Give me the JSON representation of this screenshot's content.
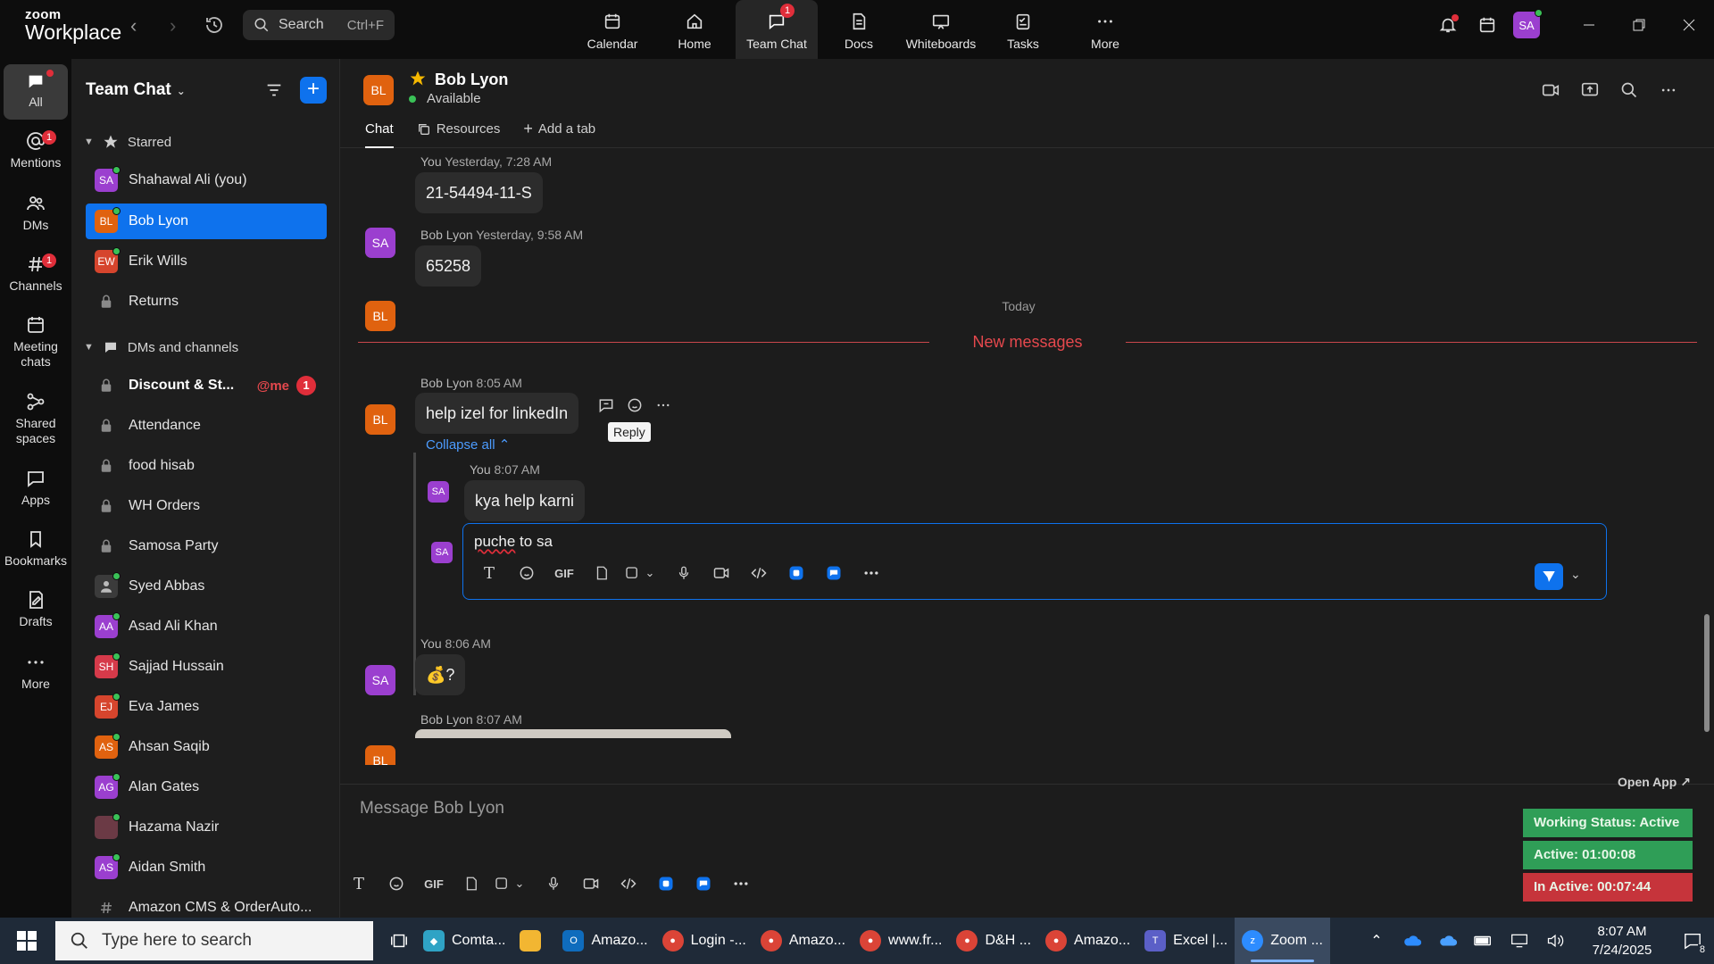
{
  "app": {
    "logo_top": "zoom",
    "logo_bottom": "Workplace"
  },
  "search": {
    "label": "Search",
    "shortcut": "Ctrl+F"
  },
  "topnav": [
    {
      "label": "Calendar",
      "icon": "calendar-icon"
    },
    {
      "label": "Home",
      "icon": "home-icon"
    },
    {
      "label": "Team Chat",
      "icon": "chat-icon",
      "badge": "1",
      "active": true
    },
    {
      "label": "Docs",
      "icon": "docs-icon"
    },
    {
      "label": "Whiteboards",
      "icon": "whiteboard-icon"
    },
    {
      "label": "Tasks",
      "icon": "tasks-icon"
    },
    {
      "label": "More",
      "icon": "more-icon"
    }
  ],
  "user": {
    "initials": "SA"
  },
  "rail": [
    {
      "label": "All"
    },
    {
      "label": "Mentions",
      "badge": "1"
    },
    {
      "label": "DMs"
    },
    {
      "label": "Channels",
      "badge": "1"
    },
    {
      "label": "Meeting chats"
    },
    {
      "label": "Shared spaces"
    },
    {
      "label": "Apps"
    },
    {
      "label": "Bookmarks"
    },
    {
      "label": "Drafts"
    },
    {
      "label": "More"
    }
  ],
  "sidebar": {
    "title": "Team Chat",
    "starred_label": "Starred",
    "starred": [
      {
        "initials": "SA",
        "name": "Shahawal Ali (you)",
        "color": "#9b3fcf"
      },
      {
        "initials": "BL",
        "name": "Bob Lyon",
        "color": "#e0620f"
      },
      {
        "initials": "EW",
        "name": "Erik Wills",
        "color": "#d6452d"
      },
      {
        "initials": "",
        "name": "Returns",
        "color": ""
      }
    ],
    "dms_label": "DMs and channels",
    "dms": [
      {
        "initials": "",
        "name": "Discount & St...",
        "mention": "@me",
        "count": "1"
      },
      {
        "initials": "",
        "name": "Attendance"
      },
      {
        "initials": "",
        "name": "food hisab"
      },
      {
        "initials": "",
        "name": "WH Orders"
      },
      {
        "initials": "",
        "name": "Samosa Party"
      },
      {
        "initials": "",
        "name": "Syed Abbas",
        "color": "#3b3b3b"
      },
      {
        "initials": "AA",
        "name": "Asad Ali Khan",
        "color": "#9b3fcf"
      },
      {
        "initials": "SH",
        "name": "Sajjad Hussain",
        "color": "#d63a4a"
      },
      {
        "initials": "EJ",
        "name": "Eva James",
        "color": "#d6452d"
      },
      {
        "initials": "AS",
        "name": "Ahsan Saqib",
        "color": "#e0620f"
      },
      {
        "initials": "AG",
        "name": "Alan Gates",
        "color": "#9b3fcf"
      },
      {
        "initials": "",
        "name": "Hazama Nazir",
        "color": "#6b3a45"
      },
      {
        "initials": "AS",
        "name": "Aidan Smith",
        "color": "#9b3fcf"
      },
      {
        "initials": "",
        "name": "Amazon CMS & OrderAuto..."
      }
    ]
  },
  "chat": {
    "contact_initials": "BL",
    "contact_name": "Bob Lyon",
    "status": "Available",
    "tabs": [
      "Chat",
      "Resources",
      "Add a tab"
    ],
    "messages": [
      {
        "initials": "SA",
        "author": "You",
        "time": "Yesterday, 7:28 AM",
        "text": "21-54494-11-S"
      },
      {
        "initials": "BL",
        "author": "Bob Lyon",
        "time": "Yesterday, 9:58 AM",
        "text": "65258"
      }
    ],
    "today_label": "Today",
    "new_messages_label": "New messages",
    "thread_parent": {
      "initials": "BL",
      "author": "Bob Lyon",
      "time": "8:05 AM",
      "text": "help izel for linkedIn"
    },
    "tooltip": "Reply",
    "collapse_label": "Collapse all",
    "thread_reply": {
      "initials": "SA",
      "author": "You",
      "time": "8:07 AM",
      "text": "kya help karni"
    },
    "reply_draft": {
      "initials": "SA",
      "word1": "puche",
      "rest": " to sa"
    },
    "later_messages": [
      {
        "initials": "SA",
        "author": "You",
        "time": "8:06 AM",
        "text": "💰?"
      },
      {
        "initials": "BL",
        "author": "Bob Lyon",
        "time": "8:07 AM"
      }
    ],
    "composer_placeholder": "Message Bob Lyon",
    "toolbar_gif": "GIF"
  },
  "widget": {
    "open_app": "Open App ↗",
    "working_status": "Working Status: Active",
    "active": "Active: 01:00:08",
    "inactive": "In Active: 00:07:44"
  },
  "taskbar": {
    "search_placeholder": "Type here to search",
    "apps": [
      {
        "label": "Comta...",
        "color": "#2fa3c5"
      },
      {
        "label": "",
        "color": "#f2b632"
      },
      {
        "label": "Amazo...",
        "color": "#0f6cbd"
      },
      {
        "label": "Login -...",
        "color": "#db4437"
      },
      {
        "label": "Amazo...",
        "color": "#db4437"
      },
      {
        "label": "www.fr...",
        "color": "#db4437"
      },
      {
        "label": "D&H ...",
        "color": "#db4437"
      },
      {
        "label": "Amazo...",
        "color": "#db4437"
      },
      {
        "label": "Excel |...",
        "color": "#5b5fc7"
      },
      {
        "label": "Zoom ...",
        "color": "#2d8cff"
      }
    ],
    "time": "8:07 AM",
    "date": "7/24/2025",
    "notifications": "8"
  }
}
